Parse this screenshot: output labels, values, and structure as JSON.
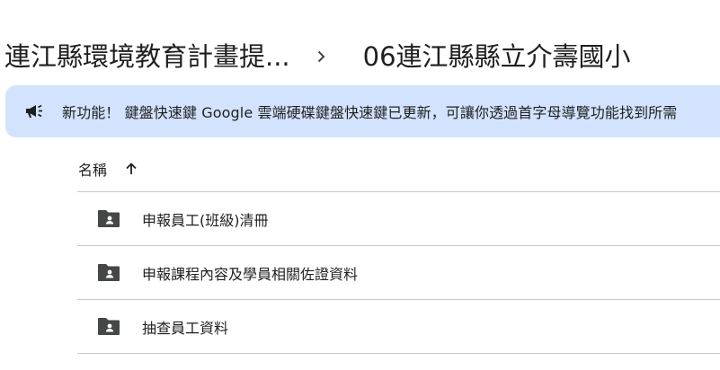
{
  "breadcrumb": {
    "parent": "連江縣環境教育計畫提...",
    "separator_icon": "chevron-right-icon",
    "current": "06連江縣縣立介壽國小"
  },
  "banner": {
    "icon": "megaphone-icon",
    "text": "新功能！ 鍵盤快速鍵 Google 雲端硬碟鍵盤快速鍵已更新，可讓你透過首字母導覽功能找到所需",
    "background": "#d3e3fd"
  },
  "list_header": {
    "name_label": "名稱",
    "sort_icon": "arrow-up-icon",
    "sort": "ascending"
  },
  "files": [
    {
      "name": "申報員工(班級)清冊",
      "icon": "shared-folder-icon"
    },
    {
      "name": "申報課程內容及學員相關佐證資料",
      "icon": "shared-folder-icon"
    },
    {
      "name": "抽查員工資料",
      "icon": "shared-folder-icon"
    }
  ]
}
